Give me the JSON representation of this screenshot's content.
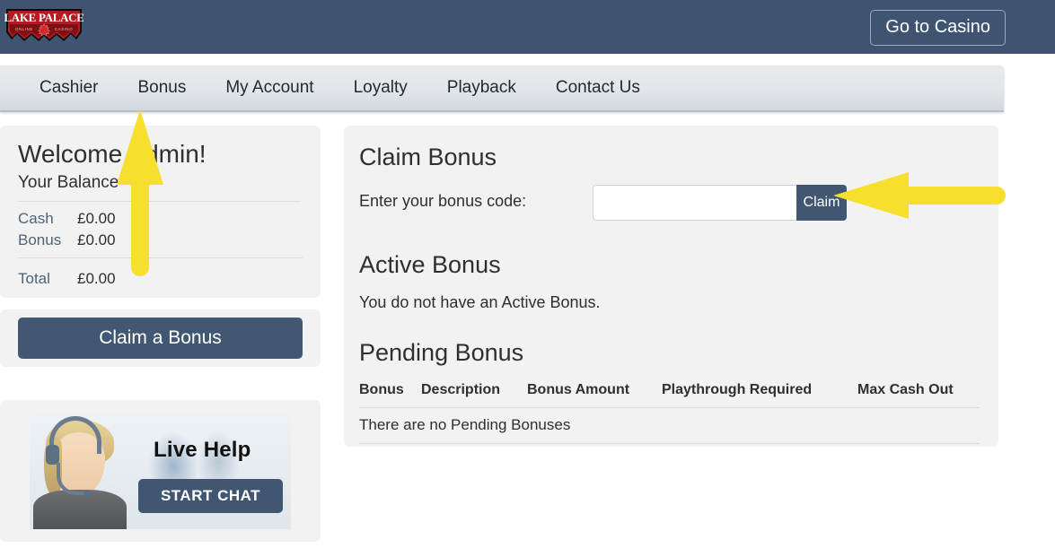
{
  "header": {
    "logo": {
      "name": "lake-palace-logo",
      "brand_line1": "LAKE PALACE",
      "brand_line2_left": "ONLINE",
      "brand_line2_right": "CASINO"
    },
    "go_to_casino_label": "Go to Casino",
    "background_color": "#3e5471"
  },
  "nav": {
    "items": [
      {
        "label": "Cashier",
        "name": "nav-item-cashier"
      },
      {
        "label": "Bonus",
        "name": "nav-item-bonus"
      },
      {
        "label": "My Account",
        "name": "nav-item-my-account"
      },
      {
        "label": "Loyalty",
        "name": "nav-item-loyalty"
      },
      {
        "label": "Playback",
        "name": "nav-item-playback"
      },
      {
        "label": "Contact Us",
        "name": "nav-item-contact-us"
      }
    ]
  },
  "sidebar": {
    "balance": {
      "welcome_title": "Welcome Admin!",
      "subtitle": "Your Balance",
      "rows": [
        {
          "label": "Cash",
          "value": "£0.00"
        },
        {
          "label": "Bonus",
          "value": "£0.00"
        }
      ],
      "total": {
        "label": "Total",
        "value": "£0.00"
      }
    },
    "claim_a_bonus_label": "Claim a Bonus",
    "live_help": {
      "title": "Live Help",
      "start_chat_label": "START CHAT"
    }
  },
  "main": {
    "claim_bonus": {
      "title": "Claim Bonus",
      "code_label": "Enter your bonus code:",
      "code_value": "",
      "code_placeholder": "",
      "claim_button_label": "Claim"
    },
    "active_bonus": {
      "title": "Active Bonus",
      "empty_text": "You do not have an Active Bonus."
    },
    "pending_bonus": {
      "title": "Pending Bonus",
      "columns": [
        "Bonus",
        "Description",
        "Bonus Amount",
        "Playthrough Required",
        "Max Cash Out"
      ],
      "empty_text": "There are no Pending Bonuses"
    }
  },
  "annotations": {
    "color": "#F7DF2E",
    "arrow_up": {
      "name": "annotation-arrow-up",
      "points_at": "nav-item-bonus"
    },
    "arrow_left": {
      "name": "annotation-arrow-left",
      "points_at": "claim-code-input"
    }
  },
  "colors": {
    "accent_dark": "#415771",
    "panel_bg": "#f2f2f2",
    "label_blue": "#4e6378",
    "logo_red": "#b11b21"
  }
}
